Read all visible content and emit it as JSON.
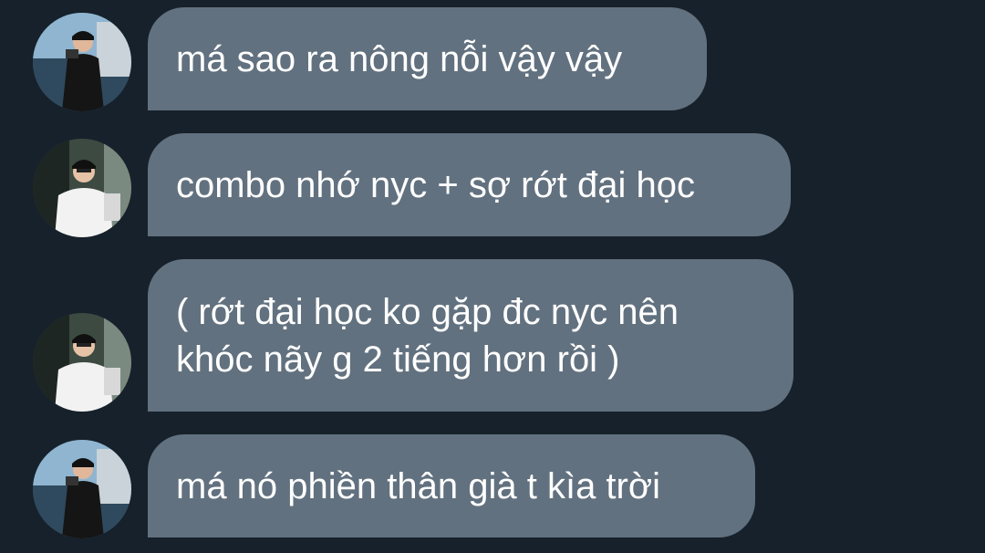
{
  "chat": {
    "background_color": "#17212b",
    "bubble_color": "#62717f",
    "messages": [
      {
        "text": "má sao ra nông nỗi vậy vậy",
        "avatar": "avatar-photo-dark-jacket"
      },
      {
        "text": "combo nhớ nyc + sợ rớt đại học",
        "avatar": "avatar-photo-white-tshirt"
      },
      {
        "text": "( rớt đại học ko gặp đc nyc nên\nkhóc nãy g 2 tiếng hơn rồi )",
        "avatar": "avatar-photo-white-tshirt"
      },
      {
        "text": "má nó phiền thân già t kìa trời",
        "avatar": "avatar-photo-dark-jacket"
      }
    ]
  }
}
